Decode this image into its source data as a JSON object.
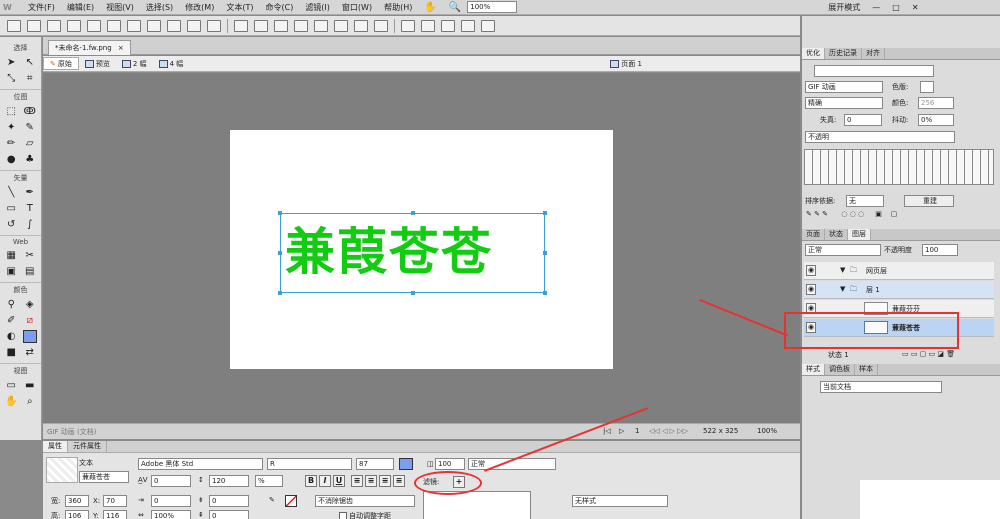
{
  "menubar": {
    "logo": "W",
    "items": [
      "文件(F)",
      "编辑(E)",
      "视图(V)",
      "选择(S)",
      "修改(M)",
      "文本(T)",
      "命令(C)",
      "滤镜(I)",
      "窗口(W)",
      "帮助(H)"
    ],
    "zoom": "100%",
    "workspace": "展开模式"
  },
  "document": {
    "tab": "*未命名-1.fw.png",
    "tab_close": "×",
    "views": [
      "原始",
      "预览",
      "2 幅",
      "4 幅"
    ],
    "page": "页面 1",
    "canvas_text": "兼葭苍苍"
  },
  "tools": {
    "groups": [
      "选择",
      "位图",
      "矢量",
      "Web",
      "颜色",
      "视图"
    ]
  },
  "statusbar": {
    "left": "GIF 动画 (文档)",
    "frame": "1",
    "size": "522 x 325",
    "zoom": "100%"
  },
  "properties": {
    "tabs": [
      "属性",
      "元件属性"
    ],
    "type_label": "文本",
    "name_value": "蒹葭苍苍",
    "font": "Adobe 黑体 Std",
    "style": "R",
    "size": "87",
    "opacity": "100",
    "blend": "正常",
    "spacing": "0",
    "leading": "120",
    "leading_unit": "%",
    "filters_label": "滤镜:",
    "filters_add": "+",
    "width_label": "宽:",
    "width": "360",
    "x_label": "X:",
    "x": "70",
    "height_label": "高:",
    "height": "106",
    "y_label": "Y:",
    "y": "116",
    "indent": "0",
    "space_after": "0",
    "scale": "100%",
    "space_before": "0",
    "anti_alias": "不消除锯齿",
    "auto_kern": "自动调整字距",
    "no_style": "无样式",
    "bold": "B",
    "italic": "I",
    "underline": "U"
  },
  "right_panel": {
    "optimize_tabs": [
      "优化",
      "历史记录",
      "对齐"
    ],
    "format": "GIF 动画",
    "matte_label": "色版:",
    "palette": "精确",
    "colors_label": "颜色:",
    "colors": "256",
    "loss_label": "失真:",
    "loss": "0",
    "dither_label": "抖动:",
    "dither": "0%",
    "transparency": "不透明",
    "sort_label": "排序依据:",
    "sort_value": "无",
    "rebuild": "重建",
    "layer_tabs": [
      "页面",
      "状态",
      "图层"
    ],
    "blend": "正常",
    "opacity_label": "不透明度",
    "opacity": "100",
    "layers": [
      {
        "name": "网页层"
      },
      {
        "name": "层 1"
      },
      {
        "name": "蒹葭芬芬"
      },
      {
        "name": "蒹葭苍苍"
      }
    ],
    "state": "状态 1",
    "style_tabs": [
      "样式",
      "调色板",
      "样本"
    ],
    "style_doc": "当前文档"
  },
  "colors": {
    "text_green": "#11cc11",
    "annotation_red": "#e53333",
    "selection_blue": "#3aa0d8"
  }
}
